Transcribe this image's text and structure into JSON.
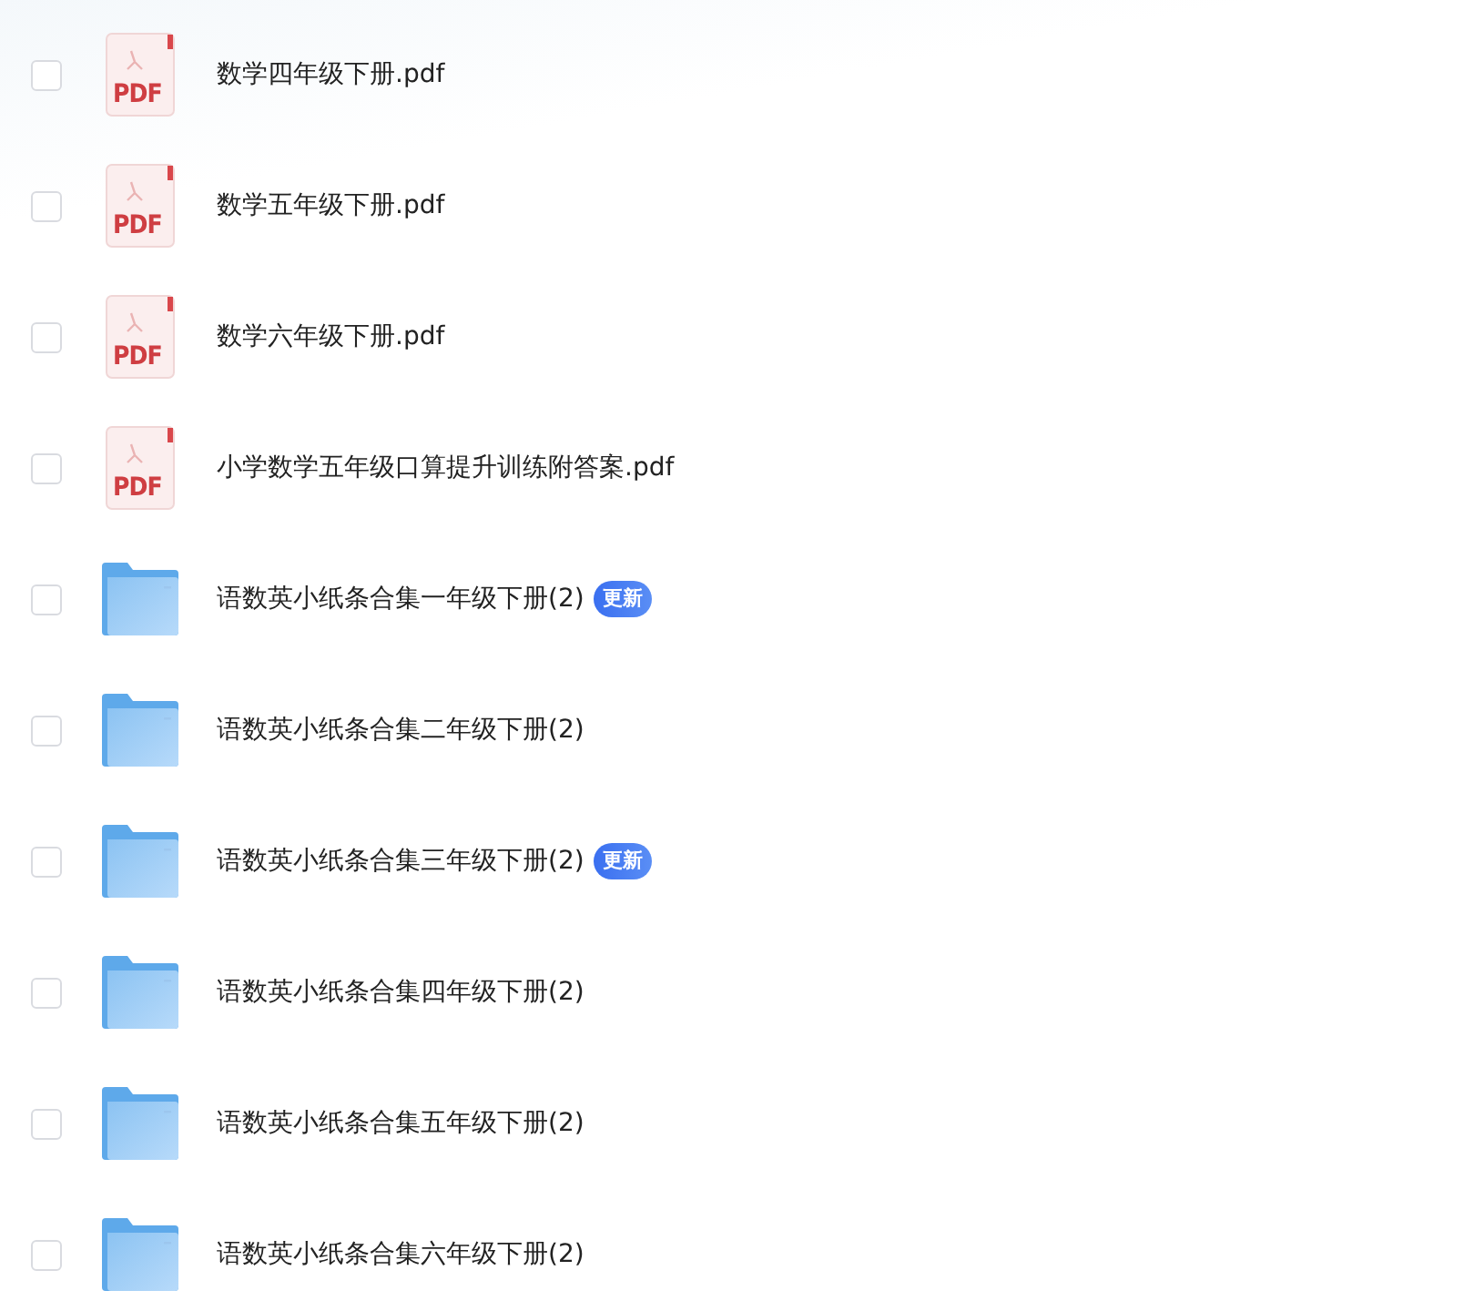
{
  "files": [
    {
      "kind": "pdf",
      "icon_label": "PDF",
      "name": "数学四年级下册.pdf",
      "checked": false
    },
    {
      "kind": "pdf",
      "icon_label": "PDF",
      "name": "数学五年级下册.pdf",
      "checked": false
    },
    {
      "kind": "pdf",
      "icon_label": "PDF",
      "name": "数学六年级下册.pdf",
      "checked": false
    },
    {
      "kind": "pdf",
      "icon_label": "PDF",
      "name": "小学数学五年级口算提升训练附答案.pdf",
      "checked": false
    },
    {
      "kind": "folder",
      "name": "语数英小纸条合集一年级下册(2)",
      "badge": "更新",
      "checked": false
    },
    {
      "kind": "folder",
      "name": "语数英小纸条合集二年级下册(2)",
      "checked": false
    },
    {
      "kind": "folder",
      "name": "语数英小纸条合集三年级下册(2)",
      "badge": "更新",
      "checked": false
    },
    {
      "kind": "folder",
      "name": "语数英小纸条合集四年级下册(2)",
      "checked": false
    },
    {
      "kind": "folder",
      "name": "语数英小纸条合集五年级下册(2)",
      "checked": false
    },
    {
      "kind": "folder",
      "name": "语数英小纸条合集六年级下册(2)",
      "checked": false
    }
  ]
}
